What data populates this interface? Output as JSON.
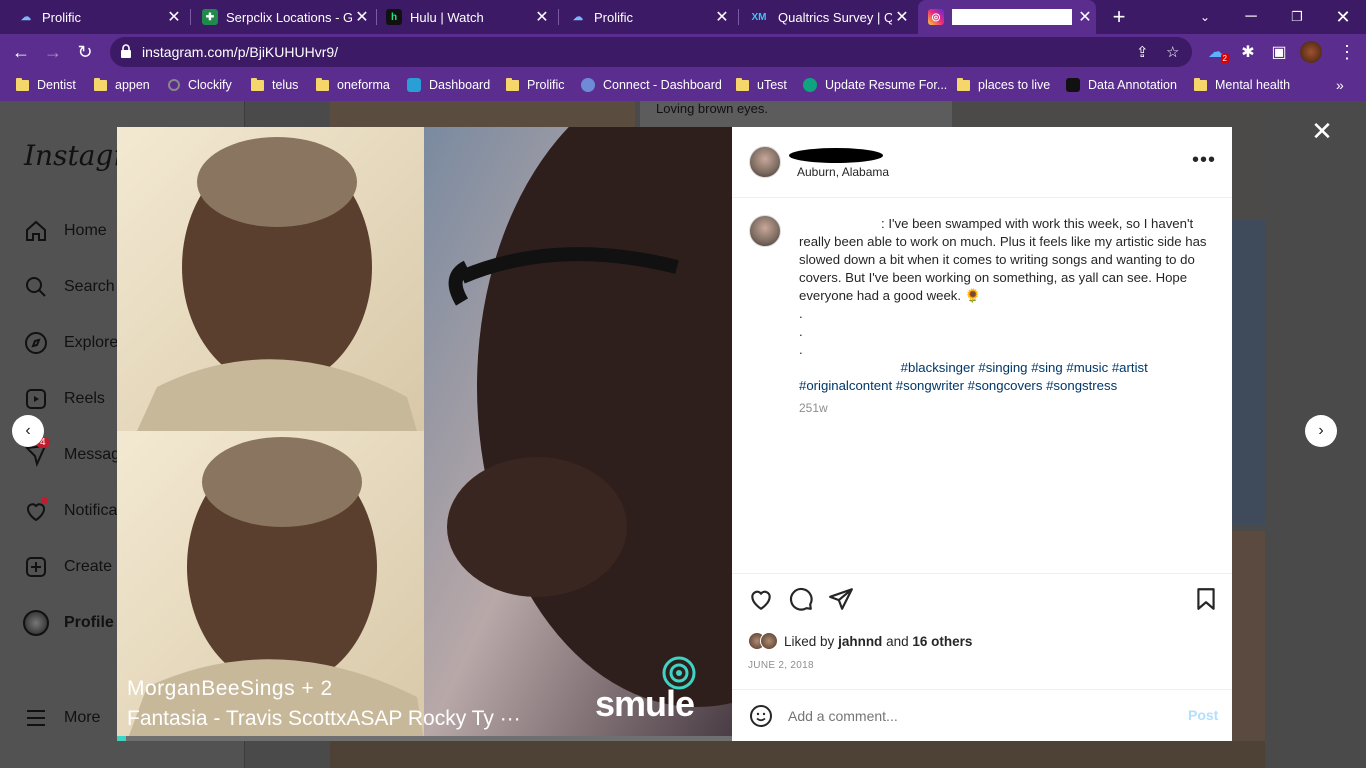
{
  "tabs": [
    {
      "label": "Prolific",
      "icon": "prolific-icon",
      "color": "#4a90e2"
    },
    {
      "label": "Serpclix Locations - Go",
      "icon": "serpclix-icon",
      "color": "#1f8a4c"
    },
    {
      "label": "Hulu | Watch",
      "icon": "hulu-icon",
      "color": "#1ce783"
    },
    {
      "label": "Prolific",
      "icon": "prolific-icon",
      "color": "#4a90e2"
    },
    {
      "label": "Qualtrics Survey | Qua",
      "icon": "qualtrics-icon",
      "color": "#3ec3f4"
    },
    {
      "label": "",
      "icon": "instagram-icon",
      "color": "#e1306c"
    }
  ],
  "address": {
    "url": "instagram.com/p/BjiKUHUHvr9/"
  },
  "bookmarks": [
    {
      "label": "Dentist"
    },
    {
      "label": "appen"
    },
    {
      "label": "Clockify"
    },
    {
      "label": "telus"
    },
    {
      "label": "oneforma"
    },
    {
      "label": "Dashboard"
    },
    {
      "label": "Prolific"
    },
    {
      "label": "Connect - Dashboard"
    },
    {
      "label": "uTest"
    },
    {
      "label": "Update Resume For..."
    },
    {
      "label": "places to live"
    },
    {
      "label": "Data Annotation"
    },
    {
      "label": "Mental health"
    }
  ],
  "extension_badge": "2",
  "sidebar": {
    "logo": "Instagram",
    "items": [
      {
        "label": "Home"
      },
      {
        "label": "Search"
      },
      {
        "label": "Explore"
      },
      {
        "label": "Reels"
      },
      {
        "label": "Messages",
        "badge": "4"
      },
      {
        "label": "Notifications"
      },
      {
        "label": "Create"
      },
      {
        "label": "Profile"
      },
      {
        "label": "More"
      }
    ]
  },
  "background_caption": "Loving brown eyes.",
  "post": {
    "location": "Auburn, Alabama",
    "caption_text": ": I've been swamped with work this week, so I haven't really been able to work on much. Plus it feels like my artistic side has slowed down a bit when it comes to writing songs and wanting to do covers. But I've been working on something, as yall can see. Hope everyone had a good week. 🌻",
    "dots": [
      ".",
      ".",
      "."
    ],
    "hashtags": [
      "#blacksinger",
      "#singing",
      "#sing",
      "#music",
      "#artist",
      "#originalcontent",
      "#songwriter",
      "#songcovers",
      "#songstress"
    ],
    "age": "251w",
    "likes_prefix": "Liked by",
    "likes_user": "jahnnd",
    "likes_and": "and",
    "likes_others": "16 others",
    "date": "JUNE 2, 2018",
    "comment_placeholder": "Add a comment...",
    "post_label": "Post"
  },
  "media": {
    "overlay_name": "MorganBeeSings + 2",
    "overlay_song": "Fantasia - Travis ScottxASAP Rocky Ty ···",
    "brand": "smule",
    "progress": 0.015
  },
  "colors": {
    "chrome": "#5b2d8e",
    "tabbar": "#3d1a66",
    "link": "#00376b",
    "post_disabled": "#b2dffc",
    "smule_accent": "#3ed3c2"
  }
}
